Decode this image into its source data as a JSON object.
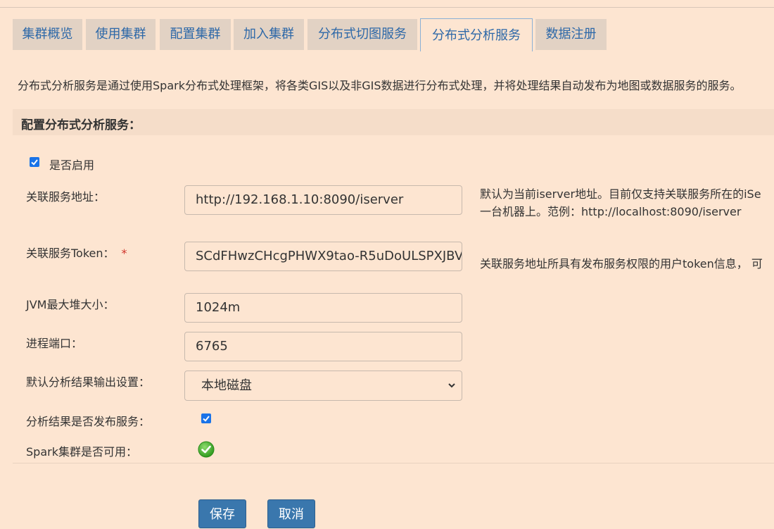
{
  "tabs": [
    {
      "label": "集群概览"
    },
    {
      "label": "使用集群"
    },
    {
      "label": "配置集群"
    },
    {
      "label": "加入集群"
    },
    {
      "label": "分布式切图服务"
    },
    {
      "label": "分布式分析服务",
      "active": true
    },
    {
      "label": "数据注册"
    }
  ],
  "description": "分布式分析服务是通过使用Spark分布式处理框架，将各类GIS以及非GIS数据进行分布式处理，并将处理结果自动发布为地图或数据服务的服务。",
  "section": {
    "title": "配置分布式分析服务："
  },
  "form": {
    "enable": {
      "label": "是否启用",
      "checked": true
    },
    "service_url": {
      "label": "关联服务地址：",
      "value": "http://192.168.1.10:8090/iserver",
      "hint_line1": "默认为当前iserver地址。目前仅支持关联服务所在的iSe",
      "hint_line2": "一台机器上。范例：http://localhost:8090/iserver"
    },
    "token": {
      "label": "关联服务Token：",
      "required_mark": "*",
      "value": "SCdFHwzCHcgPHWX9tao-R5uDoULSPXJBV",
      "hint": "关联服务地址所具有发布服务权限的用户token信息，   可"
    },
    "jvm": {
      "label": "JVM最大堆大小：",
      "value": "1024m"
    },
    "port": {
      "label": "进程端口：",
      "value": "6765"
    },
    "output": {
      "label": "默认分析结果输出设置：",
      "selected": "本地磁盘"
    },
    "publish": {
      "label": "分析结果是否发布服务：",
      "checked": true
    },
    "spark": {
      "label": "Spark集群是否可用："
    }
  },
  "buttons": {
    "save": "保存",
    "cancel": "取消"
  },
  "colors": {
    "background": "#fde5d1",
    "tab_bg": "#e2d2c4",
    "link": "#2d68a8",
    "button": "#3a77ad",
    "checkbox": "#1a73e8",
    "required": "#d0342c",
    "ok_green": "#3fae2a"
  }
}
